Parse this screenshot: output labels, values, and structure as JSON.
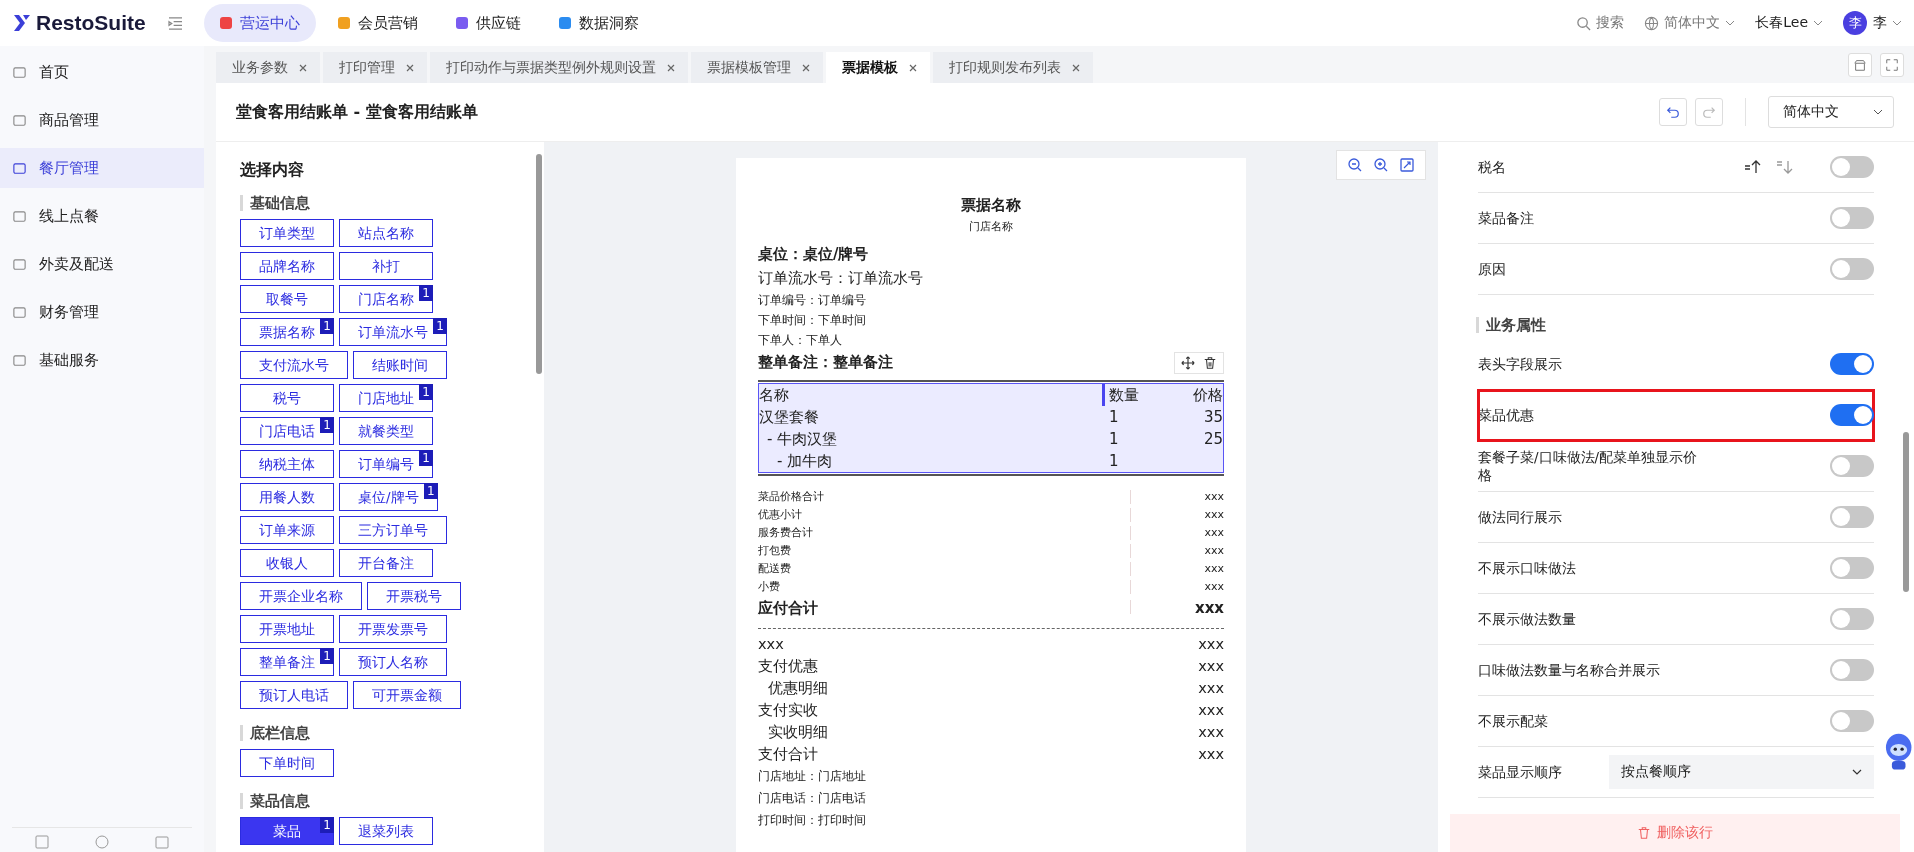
{
  "app": {
    "logo": "RestoSuite"
  },
  "top_nav": [
    {
      "label": "营运中心",
      "selected": true
    },
    {
      "label": "会员营销",
      "selected": false
    },
    {
      "label": "供应链",
      "selected": false
    },
    {
      "label": "数据洞察",
      "selected": false
    }
  ],
  "header_right": {
    "search": "搜索",
    "language": "简体中文",
    "user": "长春Lee",
    "avatar": "李",
    "avatar_label": "李"
  },
  "sidebar": {
    "items": [
      {
        "label": "首页",
        "selected": false
      },
      {
        "label": "商品管理",
        "selected": false
      },
      {
        "label": "餐厅管理",
        "selected": true
      },
      {
        "label": "线上点餐",
        "selected": false
      },
      {
        "label": "外卖及配送",
        "selected": false
      },
      {
        "label": "财务管理",
        "selected": false
      },
      {
        "label": "基础服务",
        "selected": false
      }
    ]
  },
  "tabs": [
    {
      "label": "业务参数",
      "selected": false
    },
    {
      "label": "打印管理",
      "selected": false
    },
    {
      "label": "打印动作与票据类型例外规则设置",
      "selected": false
    },
    {
      "label": "票据模板管理",
      "selected": false
    },
    {
      "label": "票据模板",
      "selected": true
    },
    {
      "label": "打印规则发布列表",
      "selected": false
    }
  ],
  "page": {
    "title": "堂食客用结账单 - 堂食客用结账单",
    "language": "简体中文"
  },
  "content_panel": {
    "title": "选择内容",
    "sections": [
      {
        "title": "基础信息",
        "chips": [
          {
            "label": "订单类型",
            "selected": false
          },
          {
            "label": "站点名称",
            "selected": false
          },
          {
            "label": "品牌名称",
            "selected": false
          },
          {
            "label": "补打",
            "selected": false
          },
          {
            "label": "取餐号",
            "selected": false
          },
          {
            "label": "门店名称",
            "selected": false,
            "badge": "1"
          },
          {
            "label": "票据名称",
            "selected": false,
            "badge": "1"
          },
          {
            "label": "订单流水号",
            "selected": false,
            "badge": "1"
          },
          {
            "label": "支付流水号",
            "selected": false
          },
          {
            "label": "结账时间",
            "selected": false
          },
          {
            "label": "税号",
            "selected": false
          },
          {
            "label": "门店地址",
            "selected": false,
            "badge": "1"
          },
          {
            "label": "门店电话",
            "selected": false,
            "badge": "1"
          },
          {
            "label": "就餐类型",
            "selected": false
          },
          {
            "label": "纳税主体",
            "selected": false
          },
          {
            "label": "订单编号",
            "selected": false,
            "badge": "1"
          },
          {
            "label": "用餐人数",
            "selected": false
          },
          {
            "label": "桌位/牌号",
            "selected": false,
            "badge": "1"
          },
          {
            "label": "订单来源",
            "selected": false
          },
          {
            "label": "三方订单号",
            "selected": false
          },
          {
            "label": "收银人",
            "selected": false
          },
          {
            "label": "开台备注",
            "selected": false
          },
          {
            "label": "开票企业名称",
            "selected": false
          },
          {
            "label": "开票税号",
            "selected": false
          },
          {
            "label": "开票地址",
            "selected": false
          },
          {
            "label": "开票发票号",
            "selected": false
          },
          {
            "label": "整单备注",
            "selected": false,
            "badge": "1"
          },
          {
            "label": "预订人名称",
            "selected": false
          },
          {
            "label": "预订人电话",
            "selected": false
          },
          {
            "label": "可开票金额",
            "selected": false
          }
        ]
      },
      {
        "title": "底栏信息",
        "chips": [
          {
            "label": "下单时间",
            "selected": false
          }
        ]
      },
      {
        "title": "菜品信息",
        "chips": [
          {
            "label": "菜品",
            "selected": true,
            "badge": "1"
          },
          {
            "label": "退菜列表",
            "selected": false
          }
        ]
      }
    ]
  },
  "receipt": {
    "title": "票据名称",
    "store": "门店名称",
    "header_fields": [
      {
        "text": "桌位：桌位/牌号",
        "kind": "bold"
      },
      {
        "text": "订单流水号：订单流水号",
        "kind": "large"
      },
      {
        "text": "订单编号：订单编号",
        "kind": "small"
      },
      {
        "text": "下单时间：下单时间",
        "kind": "small"
      },
      {
        "text": "下单人：下单人",
        "kind": "small"
      },
      {
        "text": "整单备注：整单备注",
        "kind": "bold"
      }
    ],
    "items": {
      "columns": [
        "名称",
        "数量",
        "价格"
      ],
      "rows": [
        {
          "name": "汉堡套餐",
          "qty": "1",
          "price": "35",
          "children": [
            {
              "name": "- 牛肉汉堡",
              "qty": "1",
              "price": "25",
              "children": [
                {
                  "name": "- 加牛肉",
                  "qty": "1"
                }
              ]
            }
          ]
        }
      ]
    },
    "totals": [
      {
        "label": "菜品价格合计",
        "value": "xxx",
        "kind": "small"
      },
      {
        "label": "优惠小计",
        "value": "xxx",
        "kind": "small"
      },
      {
        "label": "服务费合计",
        "value": "xxx",
        "kind": "small"
      },
      {
        "label": "打包费",
        "value": "xxx",
        "kind": "small"
      },
      {
        "label": "配送费",
        "value": "xxx",
        "kind": "small"
      },
      {
        "label": "小费",
        "value": "xxx",
        "kind": "small"
      },
      {
        "label": "应付合计",
        "value": "xxx",
        "kind": "bold"
      }
    ],
    "payments": [
      {
        "label": "xxx",
        "value": "xxx"
      },
      {
        "label": "支付优惠",
        "value": "xxx",
        "children": [
          {
            "label": "优惠明细",
            "value": "xxx"
          }
        ]
      },
      {
        "label": "支付实收",
        "value": "xxx",
        "children": [
          {
            "label": "实收明细",
            "value": "xxx"
          }
        ]
      },
      {
        "label": "支付合计",
        "value": "xxx"
      }
    ],
    "footer_fields": [
      "门店地址：门店地址",
      "门店电话：门店电话",
      "打印时间：打印时间"
    ]
  },
  "settings": {
    "rows": [
      {
        "kind": "toggle",
        "label": "税名",
        "on": false,
        "sortable": true
      },
      {
        "kind": "toggle",
        "label": "菜品备注",
        "on": false
      },
      {
        "kind": "toggle",
        "label": "原因",
        "on": false
      },
      {
        "kind": "heading",
        "label": "业务属性"
      },
      {
        "kind": "toggle",
        "label": "表头字段展示",
        "on": true
      },
      {
        "kind": "toggle",
        "label": "菜品优惠",
        "on": true,
        "highlighted": true
      },
      {
        "kind": "toggle",
        "label": "套餐子菜/口味做法/配菜单独显示价格",
        "on": false
      },
      {
        "kind": "toggle",
        "label": "做法同行展示",
        "on": false
      },
      {
        "kind": "toggle",
        "label": "不展示口味做法",
        "on": false
      },
      {
        "kind": "toggle",
        "label": "不展示做法数量",
        "on": false
      },
      {
        "kind": "toggle",
        "label": "口味做法数量与名称合并展示",
        "on": false
      },
      {
        "kind": "toggle",
        "label": "不展示配菜",
        "on": false
      },
      {
        "kind": "select",
        "label": "菜品显示顺序",
        "value": "按点餐顺序"
      }
    ],
    "delete_label": "删除该行"
  }
}
